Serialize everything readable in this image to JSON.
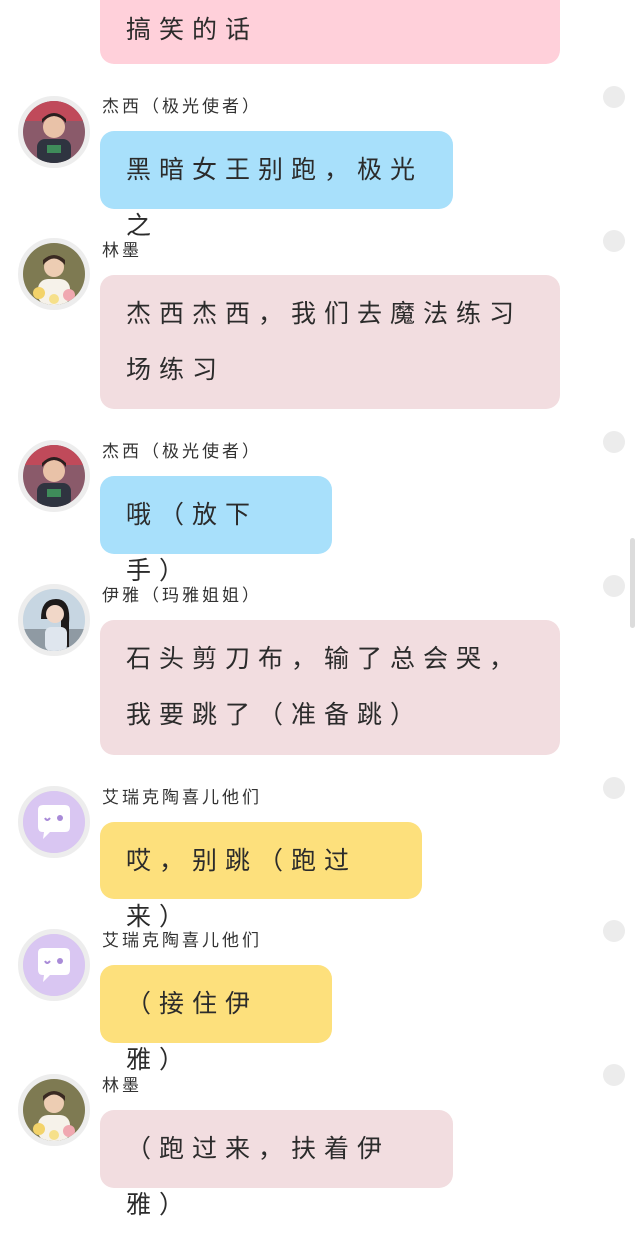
{
  "messages": [
    {
      "sender": "",
      "text": "搞笑的话",
      "color": "#ffd0da"
    },
    {
      "sender": "杰西（极光使者）",
      "text": "黑暗女王别跑，极光之",
      "color": "#a8e0fb",
      "avatar": "boy-photo-avatar"
    },
    {
      "sender": "林墨",
      "text": "杰西杰西，我们去魔法练习场练习",
      "color": "#f2dde0",
      "avatar": "flower-boy-avatar"
    },
    {
      "sender": "杰西（极光使者）",
      "text": "哦（放下手）",
      "color": "#a8e0fb",
      "avatar": "boy-photo-avatar"
    },
    {
      "sender": "伊雅（玛雅姐姐）",
      "text": "石头剪刀布，输了总会哭，我要跳了（准备跳）",
      "color": "#f2dde0",
      "avatar": "girl-photo-avatar"
    },
    {
      "sender": "艾瑞克陶喜儿他们",
      "text": "哎，别跳（跑过来）",
      "color": "#fde07c",
      "avatar": "chat-bubble-avatar"
    },
    {
      "sender": "艾瑞克陶喜儿他们",
      "text": "（接住伊雅）",
      "color": "#fde07c",
      "avatar": "chat-bubble-avatar"
    },
    {
      "sender": "林墨",
      "text": "（跑过来，扶着伊雅）",
      "color": "#f2dde0",
      "avatar": "flower-boy-avatar"
    }
  ]
}
